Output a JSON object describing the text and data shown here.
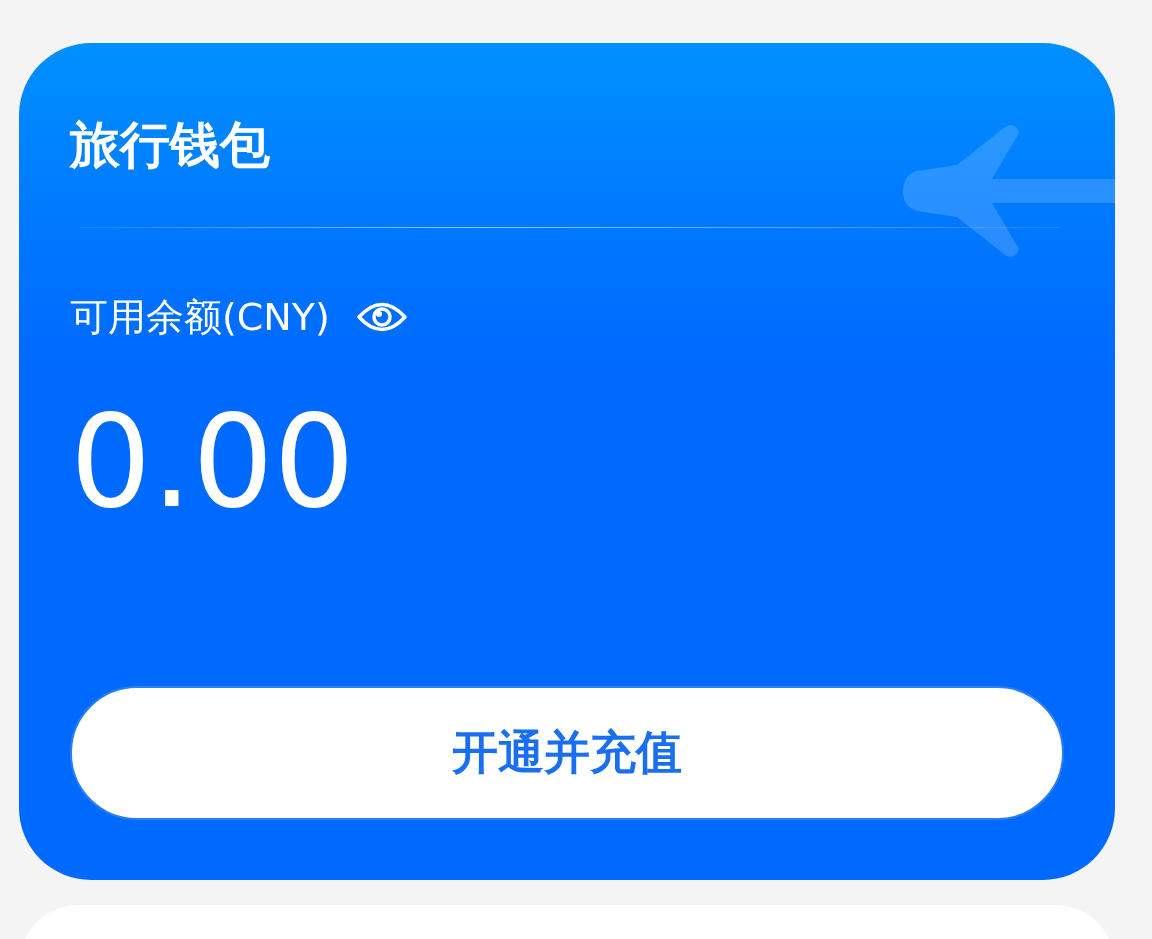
{
  "wallet_card": {
    "title": "旅行钱包",
    "balance_label": "可用余额(CNY)",
    "balance": "0.00",
    "button": "开通并充值"
  }
}
